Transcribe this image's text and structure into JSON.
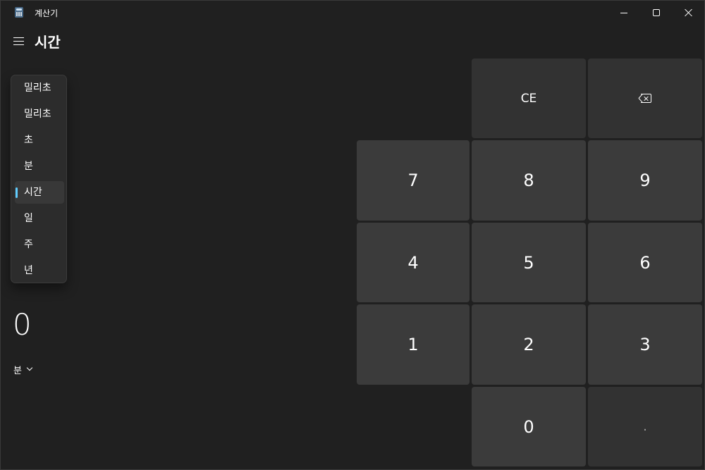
{
  "titlebar": {
    "app_title": "계산기",
    "icon": "calculator-icon"
  },
  "header": {
    "menu_icon": "hamburger-menu-icon",
    "title": "시간"
  },
  "unit_dropdown": {
    "items": [
      {
        "label": "밀리초"
      },
      {
        "label": "밀리초"
      },
      {
        "label": "초"
      },
      {
        "label": "분"
      },
      {
        "label": "시간",
        "selected": true
      },
      {
        "label": "일"
      },
      {
        "label": "주"
      },
      {
        "label": "년"
      }
    ],
    "accent_color": "#60cdff"
  },
  "output": {
    "value": "0",
    "unit": "분"
  },
  "keypad": {
    "clear_entry": "CE",
    "backspace_icon": "backspace-icon",
    "digits": [
      "7",
      "8",
      "9",
      "4",
      "5",
      "6",
      "1",
      "2",
      "3",
      "0"
    ],
    "decimal": "."
  },
  "colors": {
    "background": "#202020",
    "key": "#3b3b3b",
    "key_secondary": "#323232",
    "accent": "#60cdff"
  }
}
